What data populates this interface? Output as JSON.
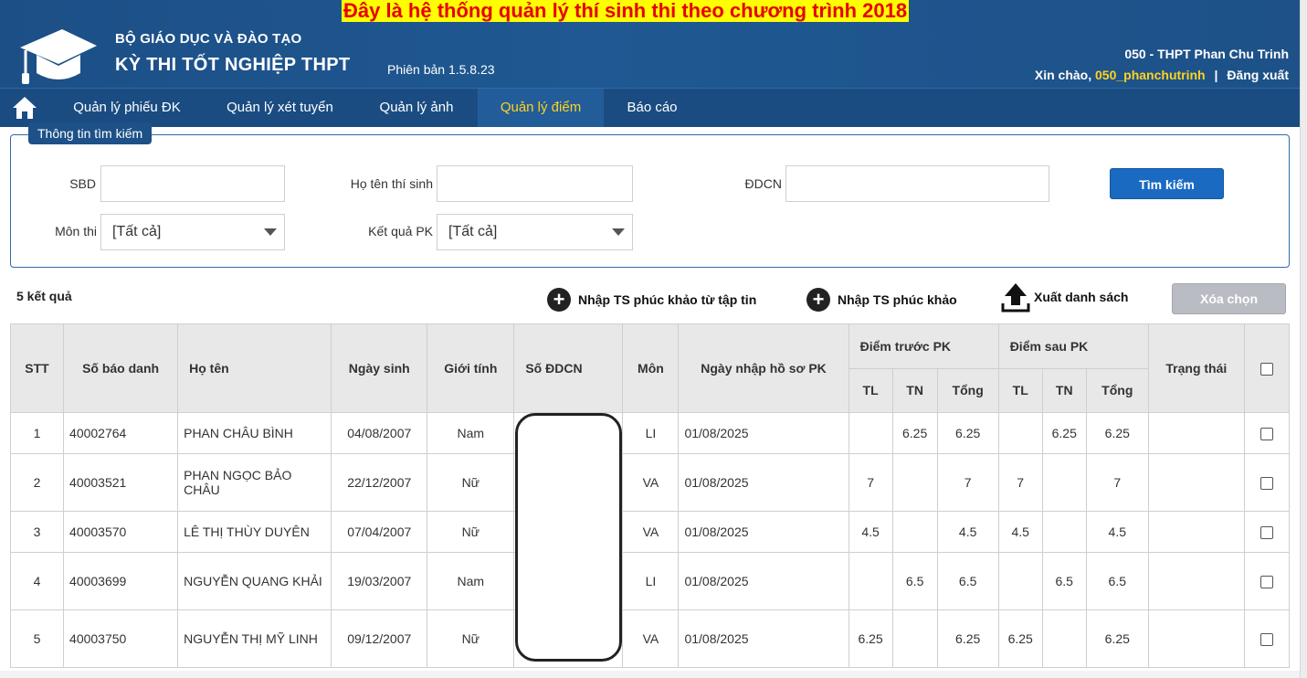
{
  "header": {
    "notice": "Đây là hệ thống quản lý thí sinh thi theo chương trình 2018",
    "org_name": "BỘ GIÁO DỤC VÀ ĐÀO TẠO",
    "exam_name": "KỲ THI TỐT NGHIỆP THPT",
    "version": "Phiên bản 1.5.8.23",
    "school": "050 - THPT Phan Chu Trinh",
    "greeting": "Xin chào,",
    "username": "050_phanchutrinh",
    "separator": "|",
    "logout": "Đăng xuất"
  },
  "nav": {
    "items": [
      {
        "label": "Quản lý phiếu ĐK"
      },
      {
        "label": "Quản lý xét tuyển"
      },
      {
        "label": "Quản lý ảnh"
      },
      {
        "label": "Quản lý điểm"
      },
      {
        "label": "Báo cáo"
      }
    ],
    "active_index": 3
  },
  "search": {
    "legend": "Thông tin tìm kiếm",
    "sbd_label": "SBD",
    "name_label": "Họ tên thí sinh",
    "ddcn_label": "ĐDCN",
    "subject_label": "Môn thi",
    "subject_value": "[Tất cả]",
    "result_label": "Kết quả PK",
    "result_value": "[Tất cả]",
    "search_button": "Tìm kiếm"
  },
  "toolbar": {
    "result_count": "5 kết quả",
    "import_file": "Nhập TS phúc khảo từ tập tin",
    "import_single": "Nhập TS phúc khảo",
    "export_list": "Xuất danh sách",
    "clear_selected": "Xóa chọn"
  },
  "table": {
    "headers": {
      "stt": "STT",
      "sbd": "Số báo danh",
      "name": "Họ tên",
      "dob": "Ngày sinh",
      "gender": "Giới tính",
      "ddcn": "Số ĐDCN",
      "subject": "Môn",
      "date": "Ngày nhập hồ sơ PK",
      "before": "Điểm trước PK",
      "after": "Điểm sau PK",
      "tl": "TL",
      "tn": "TN",
      "total": "Tổng",
      "status": "Trạng thái"
    },
    "rows": [
      {
        "stt": "1",
        "sbd": "40002764",
        "name": "PHAN CHÂU BÌNH",
        "dob": "04/08/2007",
        "gender": "Nam",
        "subject": "LI",
        "date": "01/08/2025",
        "b_tl": "",
        "b_tn": "6.25",
        "b_total": "6.25",
        "a_tl": "",
        "a_tn": "6.25",
        "a_total": "6.25",
        "status": ""
      },
      {
        "stt": "2",
        "sbd": "40003521",
        "name": "PHAN NGỌC BẢO CHÂU",
        "dob": "22/12/2007",
        "gender": "Nữ",
        "subject": "VA",
        "date": "01/08/2025",
        "b_tl": "7",
        "b_tn": "",
        "b_total": "7",
        "a_tl": "7",
        "a_tn": "",
        "a_total": "7",
        "status": ""
      },
      {
        "stt": "3",
        "sbd": "40003570",
        "name": "LÊ THỊ THÙY DUYÊN",
        "dob": "07/04/2007",
        "gender": "Nữ",
        "subject": "VA",
        "date": "01/08/2025",
        "b_tl": "4.5",
        "b_tn": "",
        "b_total": "4.5",
        "a_tl": "4.5",
        "a_tn": "",
        "a_total": "4.5",
        "status": ""
      },
      {
        "stt": "4",
        "sbd": "40003699",
        "name": "NGUYỄN QUANG KHẢI",
        "dob": "19/03/2007",
        "gender": "Nam",
        "subject": "LI",
        "date": "01/08/2025",
        "b_tl": "",
        "b_tn": "6.5",
        "b_total": "6.5",
        "a_tl": "",
        "a_tn": "6.5",
        "a_total": "6.5",
        "status": ""
      },
      {
        "stt": "5",
        "sbd": "40003750",
        "name": "NGUYỄN THỊ MỸ LINH",
        "dob": "09/12/2007",
        "gender": "Nữ",
        "subject": "VA",
        "date": "01/08/2025",
        "b_tl": "6.25",
        "b_tn": "",
        "b_total": "6.25",
        "a_tl": "6.25",
        "a_tn": "",
        "a_total": "6.25",
        "status": ""
      }
    ]
  },
  "icons": {
    "home": "home-icon",
    "graduation": "graduation-cap-icon",
    "plus": "plus-circle-icon",
    "upload": "upload-icon",
    "caret": "chevron-down-icon"
  },
  "colors": {
    "header_bg": "#1d5188",
    "nav_bg": "#1a4c82",
    "active_nav_text": "#ffd21f",
    "username_color": "#ffd21f",
    "notice_bg": "#ffff00",
    "notice_text": "#e60000",
    "primary_button": "#1a6ac2",
    "disabled_button": "#b9bcc2"
  }
}
